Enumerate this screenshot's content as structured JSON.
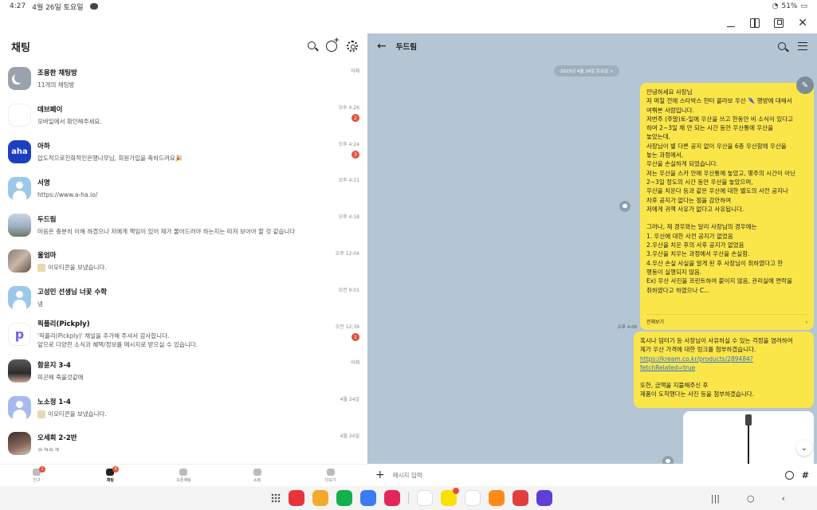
{
  "status_bar": {
    "time": "4:27",
    "date": "4월 26일 토요일",
    "battery": "51%"
  },
  "left": {
    "title": "채팅",
    "chats": [
      {
        "name": "조용한 채팅방",
        "preview": "11개의 채팅방",
        "time": "어제",
        "badge": ""
      },
      {
        "name": "데브페이",
        "preview": "모바일에서 확인해주세요.",
        "time": "오후 4:26",
        "badge": "2"
      },
      {
        "name": "아하",
        "preview": "압도적으로친화적인은행나무님, 회원가입을 축하드려요🎉",
        "time": "오후 4:24",
        "badge": "3"
      },
      {
        "name": "서명",
        "preview": "https://www.a-ha.io/",
        "time": "오후 4:21",
        "badge": ""
      },
      {
        "name": "두드림",
        "preview": "마음은 충분히 이해 하겠으나 저에게 책임이 있어 제가 물어드려야 하는지는 따져 보아야 할 것 같습니다",
        "time": "오후 4:18",
        "badge": ""
      },
      {
        "name": "울엄마",
        "preview": "이모티콘을 보냈습니다.",
        "time": "오후 12:04",
        "badge": ""
      },
      {
        "name": "고성민 선생님 너꿎 수학",
        "preview": "넹",
        "time": "오전 9:01",
        "badge": ""
      },
      {
        "name": "픽플리(Pickply)",
        "preview": "'픽플리(Pickply)' 채널을 추가해 주셔서 감사합니다.",
        "preview2": "앞으로 다양한 소식과 혜택/정보를 메시지로 받으실 수 있습니다.",
        "time": "오전 12:39",
        "badge": "1"
      },
      {
        "name": "함윤지 3-4",
        "preview": "피곤해 죽을것같애",
        "time": "어제",
        "badge": ""
      },
      {
        "name": "노소정 1-4",
        "preview": "이모티콘을 보냈습니다.",
        "time": "4월 24일",
        "badge": ""
      },
      {
        "name": "오세희 2-2반",
        "preview": "ㅇㅋㅇㅋ",
        "time": "4월 24일",
        "badge": ""
      }
    ],
    "nav": [
      {
        "label": "친구",
        "badge": "1"
      },
      {
        "label": "채팅",
        "badge": "6"
      },
      {
        "label": "오픈채팅",
        "badge": ""
      },
      {
        "label": "쇼핑",
        "badge": ""
      },
      {
        "label": "더보기",
        "badge": ""
      }
    ]
  },
  "right": {
    "title": "두드림",
    "date_pill": "2025년 4월 26일 토요일 >",
    "bubble1_lines": [
      "안녕하세요 사장님",
      "저 며칠 전에 스타박스 헌터 콜라보 우산 🌂 행방에 대해서",
      "여쭤본 사람입니다.",
      "저번주 (주말)토-일에 우산을 쓰고 한동안 비 소식이 있다고",
      "하여 2~3일 채 안 되는 시간 동안 우산통에 우산을",
      "놓았는데,",
      "사장님이 별 다른 공지 없이 우산을 6층 우산함에 우산을",
      "놓는 과정에서,",
      "우산을 손실하게 되었습니다.",
      "저는 우산을 스카 안에 우산통에 놓았고, 몇주의 시간이 아닌",
      "2~3일 정도의 시간 동안 우산을 놓았으며,",
      "우산을 치운다 등과 같은 우산에 대한 별도의 사전 공지나",
      "차후 공지가 없다는 점을 감안하여",
      "저에게 귀책 사유가 없다고 사유됩니다.",
      "",
      "그러나, 제 경우와는 달리 사장님의 경우에는",
      "1. 우산에 대한 사전 공지가 없었음",
      "2.우산을 치운 후의 사후 공지가 없었음",
      "3.우산을 치우는 과정에서 우산을 손실함.",
      "4.우산 손실 사실을 알게 된 후 사장님이 취하였다고 한",
      "행동이 실행되지 않음.",
      "Ex) 우산 사진을 프린트하여 붙이지 않음, 관리실에 연락을",
      "취하였다고 하였으나 C..."
    ],
    "bubble1_more": "전체보기",
    "bubble1_time": "오후 4:06",
    "bubble2_line1": "혹시나 덤터기 등 사장님이 사유하실 수 있는 걱정을 염려하여",
    "bubble2_line2": "제가 우산 가격에 대한 링크를 첨부하겠습니다.",
    "bubble2_link": "https://kream.co.kr/products/289484?fetchRelated=true",
    "bubble2_line3": "또한, 금액을 지불해주신 후",
    "bubble2_line4": "제품이 도착했다는 사진 등을 첨부하겠습니다.",
    "input_placeholder": "메시지 입력"
  }
}
